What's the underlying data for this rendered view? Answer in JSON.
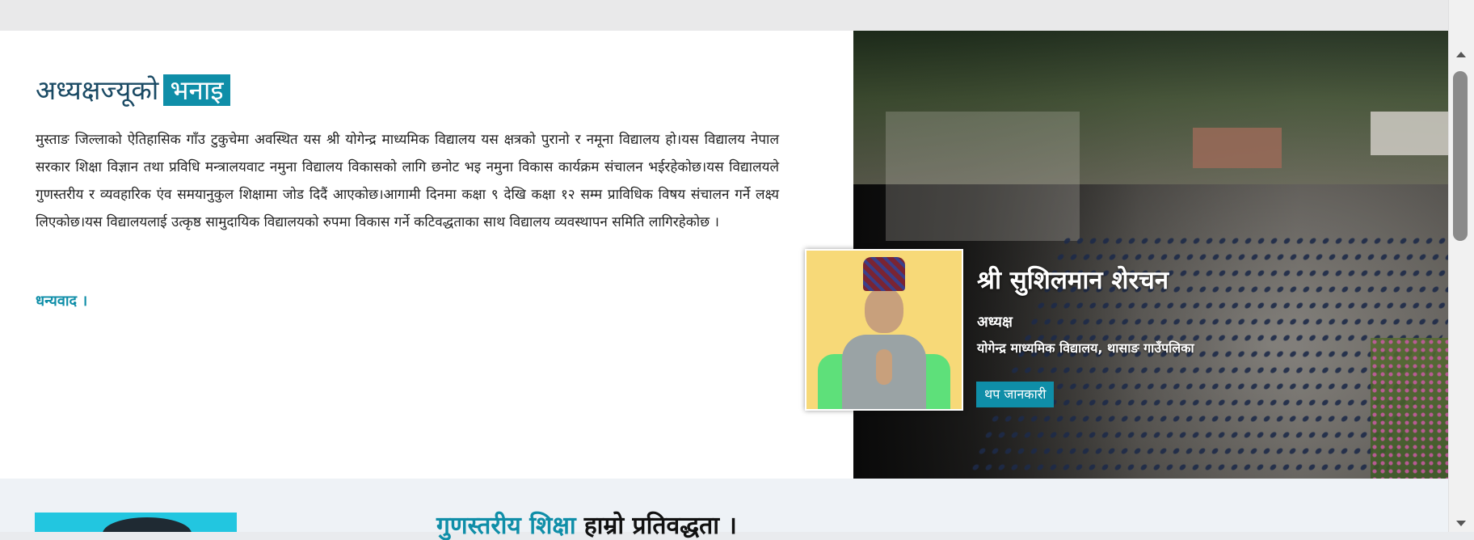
{
  "message": {
    "heading_main": "अध्यक्षज्यूको",
    "heading_highlight": "भनाइ",
    "body": "मुस्ताङ जिल्लाको ऐतिहासिक गाँउ टुकुचेमा अवस्थित यस श्री योगेन्द्र माध्यमिक विद्यालय यस क्षत्रको पुरानो र नमूना विद्यालय हो।यस विद्यालय नेपाल सरकार शिक्षा विज्ञान तथा प्रविधि मन्त्रालयवाट नमुना विद्यालय विकासको लागि छनोट भइ नमुना विकास कार्यक्रम संचालन भईरहेकोछ।यस विद्यालयले गुणस्तरीय र व्यवहारिक एंव समयानुकुल शिक्षामा जोड दिदैं आएकोछ।आगामी दिनमा कक्षा ९ देखि कक्षा १२ सम्म प्राविधिक विषय संचालन गर्ने लक्ष्य लिएकोछ।यस विद्यालयलाई उत्कृष्ठ सामुदायिक विद्यालयको रुपमा विकास गर्ने कटिवद्धताका साथ विद्यालय व्यवस्थापन समिति लागिरहेकोछ ।",
    "thanks": "धन्यवाद ।"
  },
  "profile": {
    "name": "श्री सुशिलमान शेरचन",
    "role": "अध्यक्ष",
    "organization": "योगेन्द्र माध्यमिक विद्यालय, थासाङ गाउँपलिका",
    "more_button": "थप जानकारी"
  },
  "next_section": {
    "heading_accent": "गुणस्तरीय शिक्षा",
    "heading_rest": "हाम्रो प्रतिवद्धता ।"
  },
  "colors": {
    "accent": "#0f8ea8",
    "heading_text": "#1a4a64",
    "portrait_background": "#f7d978"
  }
}
